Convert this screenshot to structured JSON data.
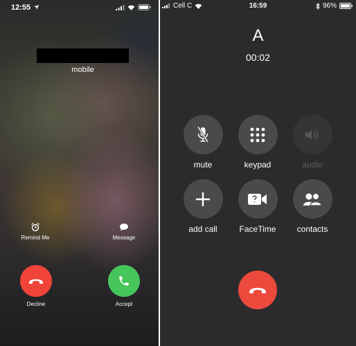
{
  "incoming": {
    "status_bar": {
      "time": "12:55"
    },
    "caller_label": "mobile",
    "actions": {
      "remind_me": "Remind Me",
      "message": "Message"
    },
    "buttons": {
      "decline": "Decline",
      "accept": "Accept"
    },
    "colors": {
      "decline": "#f0443a",
      "accept": "#46c65a"
    }
  },
  "in_call": {
    "status_bar": {
      "carrier": "Cell C",
      "time": "16:59",
      "battery": "96%"
    },
    "contact_name": "A",
    "duration": "00:02",
    "controls": [
      {
        "label": "mute",
        "icon": "mic-slash-icon",
        "enabled": true
      },
      {
        "label": "keypad",
        "icon": "keypad-icon",
        "enabled": true
      },
      {
        "label": "audio",
        "icon": "speaker-icon",
        "enabled": false
      },
      {
        "label": "add call",
        "icon": "plus-icon",
        "enabled": true
      },
      {
        "label": "FaceTime",
        "icon": "facetime-icon",
        "enabled": true
      },
      {
        "label": "contacts",
        "icon": "contacts-icon",
        "enabled": true
      }
    ],
    "colors": {
      "background": "#2b2b2d",
      "control": "#4a4a4c",
      "end_call": "#eb4a3c"
    }
  }
}
